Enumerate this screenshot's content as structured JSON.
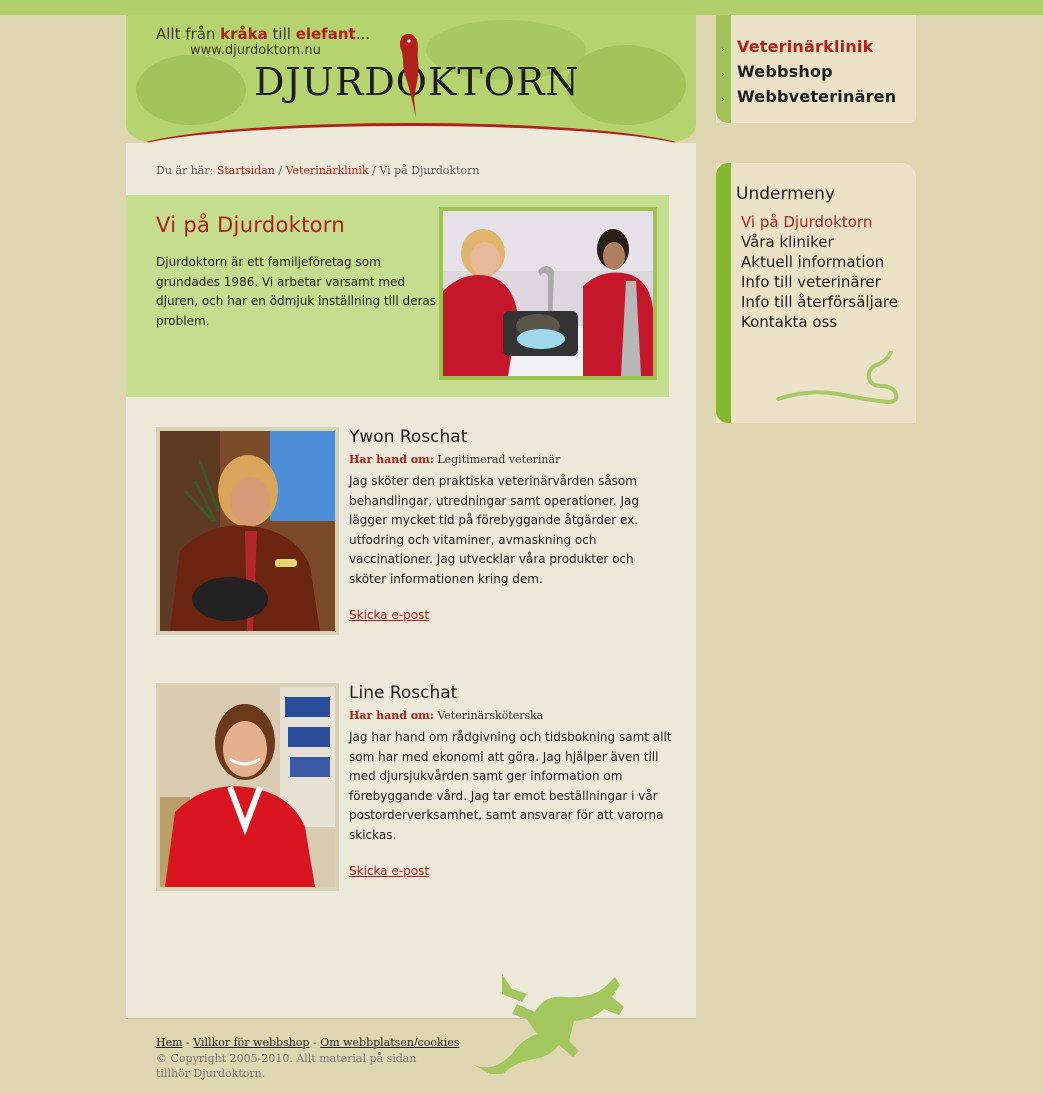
{
  "header": {
    "slogan": {
      "prefix": "Allt från ",
      "word1": "kråka",
      "mid": " till ",
      "word2": "elefant",
      "suffix": "..."
    },
    "url": "www.djurdoktorn.nu",
    "logo": "DJURDOKTORN"
  },
  "breadcrumb": {
    "prefix": "Du är här: ",
    "items": [
      "Startsidan",
      "Veterinärklinik"
    ],
    "sep": " / ",
    "current": "Vi på Djurdoktorn"
  },
  "intro": {
    "title": "Vi på Djurdoktorn",
    "text": "Djurdoktorn är ett familjeföretag som grundades 1986. Vi arbetar varsamt med djuren, och har en ödmjuk inställning till deras problem."
  },
  "people": [
    {
      "name": "Ywon Roschat",
      "role_label": "Har hand om:",
      "role": "Legitimerad veterinär",
      "desc": "Jag sköter den praktiska veterinärvården såsom behandlingar, utredningar samt operationer. Jag lägger mycket tid på förebyggande åtgärder ex. utfodring och vitaminer, avmaskning och vaccinationer. Jag utvecklar våra produkter och sköter informationen kring dem.",
      "mail_label": "Skicka e-post"
    },
    {
      "name": "Line Roschat",
      "role_label": "Har hand om:",
      "role": "Veterinärsköterska",
      "desc": "Jag har hand om rådgivning och tidsbokning samt allt som har med ekonomi att göra. Jag hjälper även till med djursjukvården samt ger information om förebyggande vård. Jag tar emot beställningar i vår postorderverksamhet, samt ansvarar för att varorna skickas.",
      "mail_label": "Skicka e-post"
    }
  ],
  "footer": {
    "links": [
      "Hem",
      "Villkor för webbshop",
      "Om webbplatsen/cookies"
    ],
    "sep": " - ",
    "copyright": "© Copyright 2005-2010. Allt material på sidan tillhör Djurdoktorn."
  },
  "nav": {
    "items": [
      "Veterinärklinik",
      "Webbshop",
      "Webbveterinären"
    ],
    "active_index": 0
  },
  "submenu": {
    "title": "Undermeny",
    "items": [
      "Vi på Djurdoktorn",
      "Våra kliniker",
      "Aktuell information",
      "Info till veterinärer",
      "Info till återförsäljare",
      "Kontakta oss"
    ],
    "active_index": 0
  },
  "colors": {
    "accent": "#b2201c",
    "green": "#b5d36f",
    "background": "#ded6b0",
    "content": "#ece8da"
  },
  "icons": {
    "arrow": "›",
    "logo_bird": "parrot-icon",
    "footer_deco": "lizard-icon",
    "submenu_deco": "snake-icon"
  }
}
